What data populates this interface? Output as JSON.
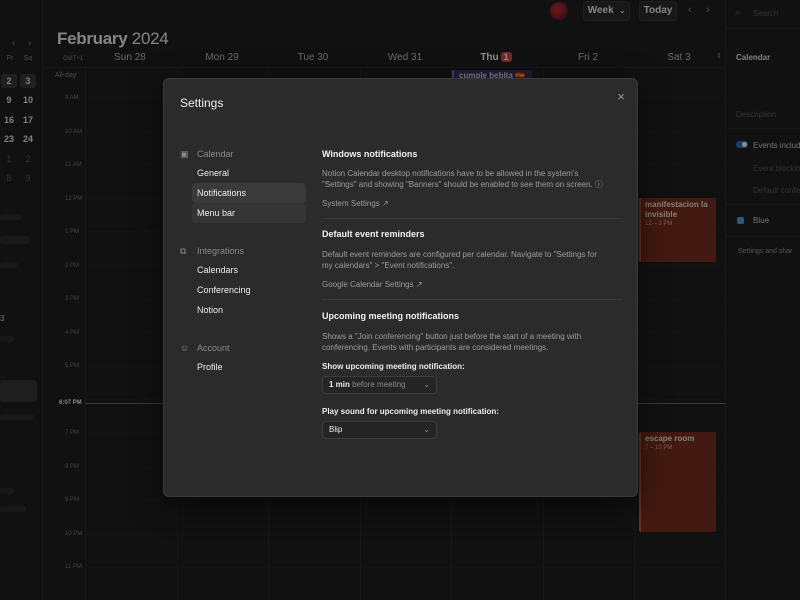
{
  "left_mini": {
    "headers": [
      "Fr",
      "Sa"
    ],
    "rows": [
      [
        "2",
        "3"
      ],
      [
        "9",
        "10"
      ],
      [
        "16",
        "17"
      ],
      [
        "23",
        "24"
      ],
      [
        "1",
        "2"
      ],
      [
        "8",
        "9"
      ]
    ],
    "nav_prev": "‹",
    "nav_next": "›",
    "badge_number": "3"
  },
  "header": {
    "month_bold": "February",
    "year": "2024",
    "view_button": "Week",
    "today_button": "Today",
    "prev_icon": "‹",
    "next_icon": "›"
  },
  "days": [
    {
      "label": "Sun 28"
    },
    {
      "label": "Mon 29"
    },
    {
      "label": "Tue 30"
    },
    {
      "label": "Wed 31"
    },
    {
      "label": "Thu",
      "badge": "1",
      "today": true
    },
    {
      "label": "Fri 2"
    },
    {
      "label": "Sat 3"
    }
  ],
  "tz_label": "GMT+1",
  "allday_label": "All-day",
  "hours": [
    "9 AM",
    "10 AM",
    "11 AM",
    "12 PM",
    "1 PM",
    "2 PM",
    "3 PM",
    "4 PM",
    "5 PM",
    "6:07 PM",
    "7 PM",
    "8 PM",
    "9 PM",
    "10 PM",
    "11 PM"
  ],
  "events": {
    "cumple": "cumple bebita 🇪🇸",
    "manifestacion_title": "manifestacion la invisible",
    "manifestacion_time": "12 – 3 PM",
    "escape_title": "escape room",
    "escape_time": "7 – 10 PM"
  },
  "right_panel": {
    "search": "Search",
    "title": "Calendar",
    "description": "Description",
    "events_included": "Events include",
    "event_blocking": "Event blocking",
    "default_conf": "Default confe",
    "color_name": "Blue",
    "settings_share": "Settings and shar"
  },
  "settings": {
    "title": "Settings",
    "close_icon": "×",
    "nav": {
      "calendar_group": "Calendar",
      "general": "General",
      "notifications": "Notifications",
      "menu_bar": "Menu bar",
      "integrations_group": "Integrations",
      "calendars": "Calendars",
      "conferencing": "Conferencing",
      "notion": "Notion",
      "account_group": "Account",
      "profile": "Profile"
    },
    "windows_notifications": {
      "title": "Windows notifications",
      "desc_line1": "Notion Calendar desktop notifications have to be allowed in the system's",
      "desc_line2": "\"Settings\" and showing \"Banners\" should be enabled to see them on screen.",
      "link": "System Settings"
    },
    "default_reminders": {
      "title": "Default event reminders",
      "desc_line1": "Default event reminders are configured per calendar. Navigate to \"Settings for",
      "desc_line2": "my calendars\" > \"Event notifications\".",
      "link": "Google Calendar Settings"
    },
    "upcoming": {
      "title": "Upcoming meeting notifications",
      "desc_line1": "Shows a \"Join conferencing\" button just before the start of a meeting with",
      "desc_line2": "conferencing. Events with participants are considered meetings.",
      "show_label": "Show upcoming meeting notification:",
      "show_value_bold": "1 min",
      "show_value_rest": "before meeting",
      "sound_label": "Play sound for upcoming meeting notification:",
      "sound_value": "Blip"
    }
  },
  "colors": {
    "accent_today": "#e0474c",
    "event_orange": "#7a3020",
    "event_purple": "#3a3566",
    "toggle_blue": "#2f6fdd"
  }
}
